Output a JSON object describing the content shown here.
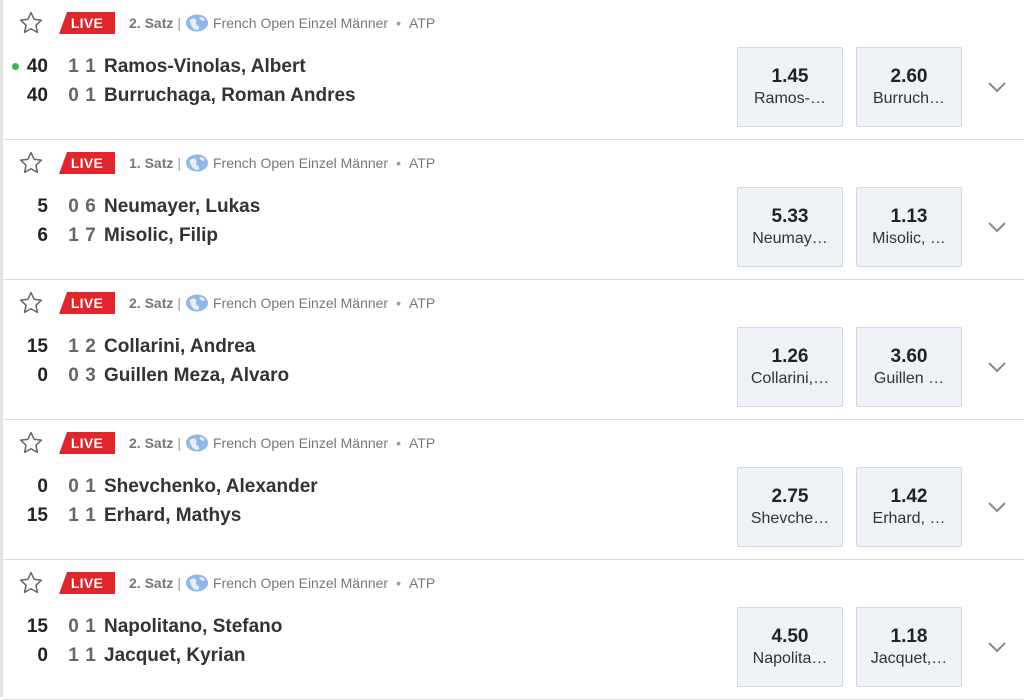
{
  "matches": [
    {
      "live": "LIVE",
      "set": "2. Satz",
      "tournament": "French Open Einzel Männer",
      "tour": "ATP",
      "players": [
        {
          "points": "40",
          "s1": "1",
          "s2": "1",
          "name": "Ramos-Vinolas, Albert",
          "serving": true
        },
        {
          "points": "40",
          "s1": "0",
          "s2": "1",
          "name": "Burruchaga, Roman Andres",
          "serving": false
        }
      ],
      "odds": [
        {
          "value": "1.45",
          "label": "Ramos-…"
        },
        {
          "value": "2.60",
          "label": "Burruch…"
        }
      ]
    },
    {
      "live": "LIVE",
      "set": "1. Satz",
      "tournament": "French Open Einzel Männer",
      "tour": "ATP",
      "players": [
        {
          "points": "5",
          "s1": "0",
          "s2": "6",
          "name": "Neumayer, Lukas",
          "serving": false
        },
        {
          "points": "6",
          "s1": "1",
          "s2": "7",
          "name": "Misolic, Filip",
          "serving": false
        }
      ],
      "odds": [
        {
          "value": "5.33",
          "label": "Neumay…"
        },
        {
          "value": "1.13",
          "label": "Misolic, …"
        }
      ]
    },
    {
      "live": "LIVE",
      "set": "2. Satz",
      "tournament": "French Open Einzel Männer",
      "tour": "ATP",
      "players": [
        {
          "points": "15",
          "s1": "1",
          "s2": "2",
          "name": "Collarini, Andrea",
          "serving": false
        },
        {
          "points": "0",
          "s1": "0",
          "s2": "3",
          "name": "Guillen Meza, Alvaro",
          "serving": false
        }
      ],
      "odds": [
        {
          "value": "1.26",
          "label": "Collarini,…"
        },
        {
          "value": "3.60",
          "label": "Guillen …"
        }
      ]
    },
    {
      "live": "LIVE",
      "set": "2. Satz",
      "tournament": "French Open Einzel Männer",
      "tour": "ATP",
      "players": [
        {
          "points": "0",
          "s1": "0",
          "s2": "1",
          "name": "Shevchenko, Alexander",
          "serving": false
        },
        {
          "points": "15",
          "s1": "1",
          "s2": "1",
          "name": "Erhard, Mathys",
          "serving": false
        }
      ],
      "odds": [
        {
          "value": "2.75",
          "label": "Shevche…"
        },
        {
          "value": "1.42",
          "label": "Erhard, …"
        }
      ]
    },
    {
      "live": "LIVE",
      "set": "2. Satz",
      "tournament": "French Open Einzel Männer",
      "tour": "ATP",
      "players": [
        {
          "points": "15",
          "s1": "0",
          "s2": "1",
          "name": "Napolitano, Stefano",
          "serving": false
        },
        {
          "points": "0",
          "s1": "1",
          "s2": "1",
          "name": "Jacquet, Kyrian",
          "serving": false
        }
      ],
      "odds": [
        {
          "value": "4.50",
          "label": "Napolita…"
        },
        {
          "value": "1.18",
          "label": "Jacquet,…"
        }
      ]
    }
  ],
  "colors": {
    "live": "#e0262d",
    "serve": "#3cb54a",
    "odd_bg": "#eef1f6"
  },
  "icons": {
    "favorite": "star-icon",
    "tournament": "globe-icon",
    "expand": "chevron-down-icon"
  }
}
